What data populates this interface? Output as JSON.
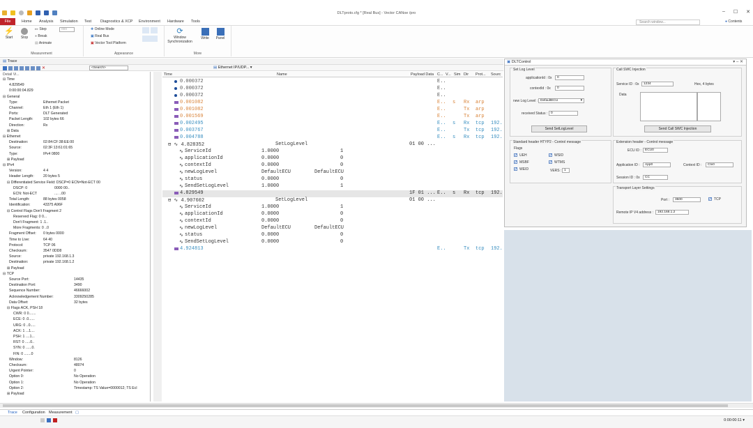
{
  "window": {
    "title": "DLTproto.cfg * [Real Bus] - Vector CANoe /pro"
  },
  "menu": {
    "file": "File",
    "items": [
      "Home",
      "Analysis",
      "Simulation",
      "Test",
      "Diagnostics & XCP",
      "Environment",
      "Hardware",
      "Tools"
    ]
  },
  "search": {
    "placeholder": "Search window...",
    "contents": "Contents"
  },
  "ribbon": {
    "start": "Start",
    "stop": "Stop",
    "step": "Step",
    "break": "Break",
    "animate": "Animate",
    "measurement_group": "Measurement",
    "online_mode": "Online Mode",
    "real_bus": "Real Bus",
    "vector_tool_platform": "Vector Tool Platform",
    "appearance_group": "Appearance",
    "window_sync": "Window\nSynchronization",
    "write": "Write",
    "panel": "Panel",
    "more_group": "More",
    "speed_value": "000"
  },
  "trace": {
    "title": "Trace",
    "search_placeholder": "<Search>",
    "filter_label": "Ethernet IP/UDP...",
    "detail_view_label": "Detail Vi...",
    "columns": [
      "Time",
      "Name",
      "Payload Data",
      "C...",
      "V...",
      "Sim",
      "Dir",
      "Prot...",
      "Sourc"
    ]
  },
  "detail": [
    {
      "l": "⊟ Time",
      "v": "",
      "i": 0
    },
    {
      "l": "4.829549",
      "v": "",
      "i": 3
    },
    {
      "l": "0:00:00:04.829",
      "v": "",
      "i": 3
    },
    {
      "l": "⊟ General",
      "v": "",
      "i": 0
    },
    {
      "l": "Type:",
      "v": "Ethernet Packet",
      "i": 3
    },
    {
      "l": "Channel:",
      "v": "Eth 1 (Eth 1)",
      "i": 3
    },
    {
      "l": "Ports:",
      "v": "DLT Generated",
      "i": 3
    },
    {
      "l": "Packet Length:",
      "v": "102 bytes          66",
      "i": 3
    },
    {
      "l": "Direction:",
      "v": "Rx",
      "i": 3
    },
    {
      "l": "⊞ Data",
      "v": "",
      "i": 2
    },
    {
      "l": "⊟ Ethernet",
      "v": "",
      "i": 0
    },
    {
      "l": "Destination:",
      "v": "02:84:CF:38:EE:00",
      "i": 3
    },
    {
      "l": "Source:",
      "v": "02:3F:13:61:01:65",
      "i": 3
    },
    {
      "l": "Type:",
      "v": "IPv4   0800",
      "i": 3
    },
    {
      "l": "⊞ Payload",
      "v": "",
      "i": 2
    },
    {
      "l": "⊟ IPv4",
      "v": "",
      "i": 0
    },
    {
      "l": "Version:",
      "v": "4              4",
      "i": 3
    },
    {
      "l": "Header Length:",
      "v": "20 bytes     5",
      "i": 3
    },
    {
      "l": "⊟ Differentiated Service Field:  DSCP=0 ECN=Not-ECT  00",
      "v": "",
      "i": 2
    },
    {
      "l": "DSCP:   0",
      "v": "0000 00..",
      "i": 5
    },
    {
      "l": "ECN:   Not-ECT",
      "v": ".... ..00",
      "i": 5
    },
    {
      "l": "Total Length:",
      "v": "88 bytes     0058",
      "i": 3
    },
    {
      "l": "Identification:",
      "v": "43375     A96F",
      "i": 3
    },
    {
      "l": "⊟ Control Flags   Don't Fragment   2",
      "v": "",
      "i": 2
    },
    {
      "l": "Reserved Flag:   0   0...",
      "v": "",
      "i": 5
    },
    {
      "l": "Don't Fragment:   1   .1..",
      "v": "",
      "i": 5
    },
    {
      "l": "More Fragments:   0   ..0",
      "v": "",
      "i": 5
    },
    {
      "l": "Fragment Offset:",
      "v": "0 bytes        0000",
      "i": 3
    },
    {
      "l": "Time to Live:",
      "v": "64              40",
      "i": 3
    },
    {
      "l": "Protocol:",
      "v": "TCP              06",
      "i": 3
    },
    {
      "l": "Checksum:",
      "v": "3547          0DD8",
      "i": 3
    },
    {
      "l": "Source:",
      "v": "private       192.168.1.3",
      "i": 3
    },
    {
      "l": "Destination:",
      "v": "private       192.168.1.2",
      "i": 3
    },
    {
      "l": "⊞ Payload",
      "v": "",
      "i": 2
    },
    {
      "l": "⊟ TCP",
      "v": "",
      "i": 0
    },
    {
      "l": "Source Port:",
      "v": "14435",
      "i": 3
    },
    {
      "l": "Destination Port:",
      "v": "3490",
      "i": 3
    },
    {
      "l": "Sequence Number:",
      "v": "46666002",
      "i": 3
    },
    {
      "l": "Acknowledgement Number:",
      "v": "3309250285",
      "i": 3
    },
    {
      "l": "Data Offset:",
      "v": "32 bytes",
      "i": 3
    },
    {
      "l": "⊟ Flags   ACK, PSH   18",
      "v": "",
      "i": 2
    },
    {
      "l": "CWR:   0   0.......",
      "v": "",
      "i": 5
    },
    {
      "l": "ECE:   0   .0......",
      "v": "",
      "i": 5
    },
    {
      "l": "URG:   0   ..0.....",
      "v": "",
      "i": 5
    },
    {
      "l": "ACK:   1   ...1....",
      "v": "",
      "i": 5
    },
    {
      "l": "PSH:   1   ....1...",
      "v": "",
      "i": 5
    },
    {
      "l": "RST:   0   .....0..",
      "v": "",
      "i": 5
    },
    {
      "l": "SYN:   0   ......0.",
      "v": "",
      "i": 5
    },
    {
      "l": "FIN:   0   .......0",
      "v": "",
      "i": 5
    },
    {
      "l": "Window:",
      "v": "8126",
      "i": 3
    },
    {
      "l": "Checksum:",
      "v": "48074",
      "i": 3
    },
    {
      "l": "Urgent Pointer:",
      "v": "0",
      "i": 3
    },
    {
      "l": "Option 0:",
      "v": "No Operation",
      "i": 3
    },
    {
      "l": "Option 1:",
      "v": "No Operation",
      "i": 3
    },
    {
      "l": "Option 2:",
      "v": "Timestamp: TS Value=0000012; TS Ecl",
      "i": 3
    },
    {
      "l": "⊞ Payload",
      "v": "",
      "i": 2
    }
  ],
  "rows": [
    {
      "time": "0.000372",
      "name": "",
      "payload": "",
      "c": "E..",
      "v": "",
      "dir": "",
      "prot": "",
      "src": "",
      "color": "#555",
      "ico": "dot"
    },
    {
      "time": "0.000372",
      "name": "",
      "payload": "",
      "c": "E..",
      "v": "",
      "dir": "",
      "prot": "",
      "src": "",
      "color": "#555",
      "ico": "dot"
    },
    {
      "time": "0.000372",
      "name": "",
      "payload": "",
      "c": "E..",
      "v": "",
      "dir": "",
      "prot": "",
      "src": "",
      "color": "#555",
      "ico": "dot"
    },
    {
      "time": "0.001082",
      "name": "",
      "payload": "",
      "c": "E..",
      "v": "s",
      "dir": "Rx",
      "prot": "arp",
      "src": "",
      "color": "#d9843a",
      "ico": "bar"
    },
    {
      "time": "0.001082",
      "name": "",
      "payload": "",
      "c": "E..",
      "v": "",
      "dir": "Tx",
      "prot": "arp",
      "src": "",
      "color": "#d9843a",
      "ico": "bar"
    },
    {
      "time": "0.001569",
      "name": "",
      "payload": "",
      "c": "E..",
      "v": "",
      "dir": "Tx",
      "prot": "arp",
      "src": "",
      "color": "#d9843a",
      "ico": "bar"
    },
    {
      "time": "0.002495",
      "name": "",
      "payload": "",
      "c": "E..",
      "v": "s",
      "dir": "Rx",
      "prot": "tcp",
      "src": "192.",
      "color": "#3a8fc0",
      "ico": "bar"
    },
    {
      "time": "0.003767",
      "name": "",
      "payload": "",
      "c": "E..",
      "v": "",
      "dir": "Tx",
      "prot": "tcp",
      "src": "192.",
      "color": "#3a8fc0",
      "ico": "bar"
    },
    {
      "time": "0.004788",
      "name": "",
      "payload": "",
      "c": "E..",
      "v": "s",
      "dir": "Rx",
      "prot": "tcp",
      "src": "192.",
      "color": "#3a8fc0",
      "ico": "bar"
    },
    {
      "time": "⊟ ∿ 4.828352",
      "name": "SetLogLevel",
      "payload": "01 00  ...",
      "c": "",
      "v": "",
      "dir": "",
      "prot": "",
      "src": "",
      "color": "#333",
      "ico": ""
    },
    {
      "time": "ServiceId",
      "name": "1.0000",
      "payload": "",
      "extra": "1",
      "c": "",
      "v": "",
      "dir": "",
      "prot": "",
      "src": "",
      "color": "#333",
      "ico": "sig"
    },
    {
      "time": "applicationId",
      "name": "0.0000",
      "payload": "",
      "extra": "0",
      "c": "",
      "v": "",
      "dir": "",
      "prot": "",
      "src": "",
      "color": "#333",
      "ico": "sig"
    },
    {
      "time": "contextId",
      "name": "0.0000",
      "payload": "",
      "extra": "0",
      "c": "",
      "v": "",
      "dir": "",
      "prot": "",
      "src": "",
      "color": "#333",
      "ico": "sig"
    },
    {
      "time": "newLogLevel",
      "name": "DefaultECU",
      "payload": "",
      "extra": "DefaultECU",
      "c": "",
      "v": "",
      "dir": "",
      "prot": "",
      "src": "",
      "color": "#333",
      "ico": "sig"
    },
    {
      "time": "status",
      "name": "0.0000",
      "payload": "",
      "extra": "0",
      "c": "",
      "v": "",
      "dir": "",
      "prot": "",
      "src": "",
      "color": "#333",
      "ico": "sig"
    },
    {
      "time": "SendSetLogLevel",
      "name": "1.0000",
      "payload": "",
      "extra": "1",
      "c": "",
      "v": "",
      "dir": "",
      "prot": "",
      "src": "",
      "color": "#333",
      "ico": "sig"
    },
    {
      "time": "4.829549",
      "name": "",
      "payload": "1F 01  ...",
      "c": "E..",
      "v": "s",
      "dir": "Rx",
      "prot": "tcp",
      "src": "192.",
      "color": "#333",
      "ico": "bar",
      "sel": true
    },
    {
      "time": "⊟ ∿ 4.907602",
      "name": "SetLogLevel",
      "payload": "01 00  ...",
      "c": "",
      "v": "",
      "dir": "",
      "prot": "",
      "src": "",
      "color": "#333",
      "ico": ""
    },
    {
      "time": "ServiceId",
      "name": "1.0000",
      "payload": "",
      "extra": "1",
      "c": "",
      "v": "",
      "dir": "",
      "prot": "",
      "src": "",
      "color": "#333",
      "ico": "sig"
    },
    {
      "time": "applicationId",
      "name": "0.0000",
      "payload": "",
      "extra": "0",
      "c": "",
      "v": "",
      "dir": "",
      "prot": "",
      "src": "",
      "color": "#333",
      "ico": "sig"
    },
    {
      "time": "contextId",
      "name": "0.0000",
      "payload": "",
      "extra": "0",
      "c": "",
      "v": "",
      "dir": "",
      "prot": "",
      "src": "",
      "color": "#333",
      "ico": "sig"
    },
    {
      "time": "newLogLevel",
      "name": "DefaultECU",
      "payload": "",
      "extra": "DefaultECU",
      "c": "",
      "v": "",
      "dir": "",
      "prot": "",
      "src": "",
      "color": "#333",
      "ico": "sig"
    },
    {
      "time": "status",
      "name": "0.0000",
      "payload": "",
      "extra": "0",
      "c": "",
      "v": "",
      "dir": "",
      "prot": "",
      "src": "",
      "color": "#333",
      "ico": "sig"
    },
    {
      "time": "SendSetLogLevel",
      "name": "0.0000",
      "payload": "",
      "extra": "0",
      "c": "",
      "v": "",
      "dir": "",
      "prot": "",
      "src": "",
      "color": "#333",
      "ico": "sig"
    },
    {
      "time": "4.924813",
      "name": "",
      "payload": "",
      "c": "E..",
      "v": "",
      "dir": "Tx",
      "prot": "tcp",
      "src": "192.",
      "color": "#3a8fc0",
      "ico": "bar"
    }
  ],
  "dlt": {
    "title": "DLTControl",
    "set_log_level": {
      "title": "Set Log Level",
      "app_label": "applicationId : 0x",
      "app_val": "0",
      "ctx_label": "contextId : 0x",
      "ctx_val": "0",
      "new_label": "new Log Level :",
      "new_val": "DefaultECU",
      "recv_label": "received Status :",
      "recv_val": "0",
      "button": "Send SetLogLevel"
    },
    "swc": {
      "title": "Call SWC Injection",
      "service_label": "Service ID : 0x",
      "service_val": "1234",
      "hex_note": "Hex, 4 bytes",
      "data_label": "Data",
      "button": "Send Call SWC Injection"
    },
    "std": {
      "title": "Standard header HTYP2 - Control message",
      "flags": "Flags",
      "ueh": "UEH",
      "msbf": "MSBF",
      "weid": "WEID",
      "wsid": "WSID",
      "wtms": "WTMS",
      "vers_label": "VERS :",
      "vers_val": "1"
    },
    "ext": {
      "title": "Extension header - Control message",
      "ecu_label": "ECU ID :",
      "ecu_val": "ECU0",
      "app_label": "Application ID :",
      "app_val": "App0",
      "ctx_label": "Context ID :",
      "ctx_val": "Ctx0",
      "session_label": "Session ID : 0x",
      "session_val": "CC"
    },
    "tl": {
      "title": "Transport Layer Settings",
      "port_label": "Port :",
      "port_val": "3500",
      "tcp": "TCP",
      "ip_label": "Remote IP V4 address :",
      "ip_val": "192.168.1.2"
    }
  },
  "bottom_tabs": [
    "Trace",
    "Configuration",
    "Measurement"
  ],
  "status": {
    "time": "0:00:00:11"
  }
}
